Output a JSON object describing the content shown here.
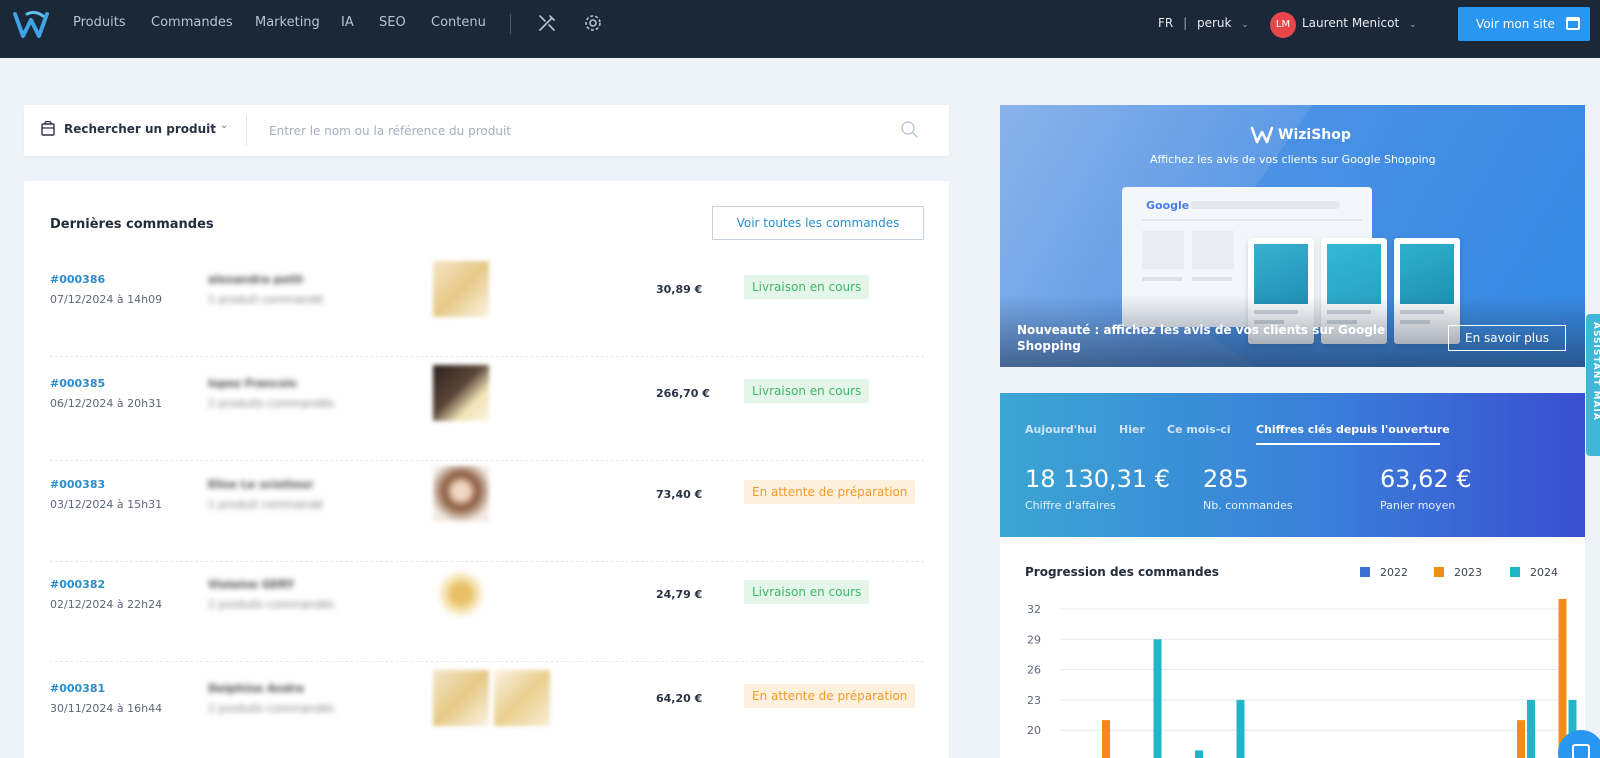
{
  "nav": {
    "items": [
      "Produits",
      "Commandes",
      "Marketing",
      "IA",
      "SEO",
      "Contenu"
    ],
    "lang": "FR",
    "shop": "peruk",
    "user_initials": "LM",
    "user_name": "Laurent Menicot",
    "site_button": "Voir mon site"
  },
  "search": {
    "type_label": "Rechercher un produit",
    "placeholder": "Entrer le nom ou la référence du produit"
  },
  "orders": {
    "title": "Dernières commandes",
    "see_all": "Voir toutes les commandes",
    "rows": [
      {
        "num": "#000386",
        "date": "07/12/2024 à 14h09",
        "customer": "alexandra petit",
        "products": "1 produit commandé",
        "amount": "30,89 €",
        "status": "Livraison en cours",
        "status_type": "green",
        "thumbs": 1
      },
      {
        "num": "#000385",
        "date": "06/12/2024 à 20h31",
        "customer": "lopez Francois",
        "products": "2 produits commandés",
        "amount": "266,70 €",
        "status": "Livraison en cours",
        "status_type": "green",
        "thumbs": 1
      },
      {
        "num": "#000383",
        "date": "03/12/2024 à 15h31",
        "customer": "Elise Le sciotiour",
        "products": "1 produit commandé",
        "amount": "73,40 €",
        "status": "En attente de préparation",
        "status_type": "orange",
        "thumbs": 1
      },
      {
        "num": "#000382",
        "date": "02/12/2024 à 22h24",
        "customer": "Violaine GERY",
        "products": "2 produits commandés",
        "amount": "24,79 €",
        "status": "Livraison en cours",
        "status_type": "green",
        "thumbs": 1
      },
      {
        "num": "#000381",
        "date": "30/11/2024 à 16h44",
        "customer": "Delphine Andre",
        "products": "2 produits commandés",
        "amount": "64,20 €",
        "status": "En attente de préparation",
        "status_type": "orange",
        "thumbs": 2
      }
    ]
  },
  "banner": {
    "brand": "WiziShop",
    "tagline": "Affichez les avis de vos clients sur Google Shopping",
    "google": "Google",
    "headline": "Nouveauté : affichez les avis de vos clients sur Google Shopping",
    "learn_more": "En savoir plus"
  },
  "stats": {
    "tabs": [
      "Aujourd'hui",
      "Hier",
      "Ce mois-ci",
      "Chiffres clés depuis l'ouverture"
    ],
    "active_tab": 3,
    "kpis": [
      {
        "value": "18 130,31 €",
        "label": "Chiffre d'affaires"
      },
      {
        "value": "285",
        "label": "Nb. commandes"
      },
      {
        "value": "63,62 €",
        "label": "Panier moyen"
      }
    ]
  },
  "assistant_label": "ASSISTANT MAIA",
  "colors": {
    "series_2022": "#3b6fd1",
    "series_2023": "#f28c18",
    "series_2024": "#22b5c9",
    "accent": "#2997f1"
  },
  "chart_data": {
    "type": "bar",
    "title": "Progression des commandes",
    "series": [
      {
        "name": "2022",
        "values": [
          0,
          0,
          0,
          0,
          0,
          0,
          0,
          0,
          0,
          0,
          0,
          0
        ]
      },
      {
        "name": "2023",
        "values": [
          21,
          0,
          0,
          0,
          0,
          0,
          0,
          0,
          0,
          0,
          21,
          33
        ]
      },
      {
        "name": "2024",
        "values": [
          0,
          29,
          18,
          23,
          0,
          0,
          0,
          0,
          0,
          0,
          23,
          23
        ]
      }
    ],
    "yticks": [
      20,
      23,
      26,
      29,
      32
    ],
    "ylim": [
      17,
      33
    ],
    "grid": true,
    "legend": "top-right"
  }
}
